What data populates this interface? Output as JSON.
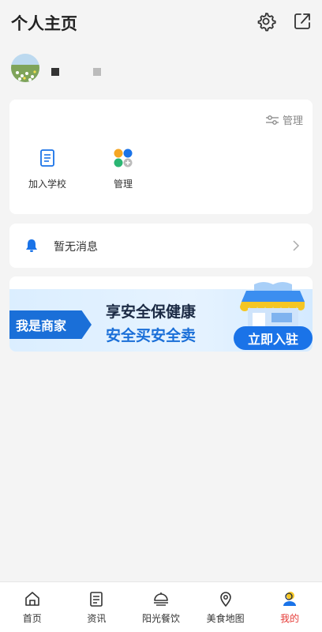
{
  "header": {
    "title": "个人主页"
  },
  "apps_card": {
    "manage_link": "管理",
    "apps": [
      {
        "label": "加入学校",
        "icon": "document-icon"
      },
      {
        "label": "管理",
        "icon": "app-grid-icon"
      }
    ]
  },
  "message": {
    "text": "暂无消息"
  },
  "banner": {
    "merchant_label": "我是商家",
    "slogan_line1": "享安全保健康",
    "slogan_line2": "安全买安全卖",
    "join_button": "立即入驻"
  },
  "tabs": [
    {
      "label": "首页",
      "icon": "home-icon",
      "active": false
    },
    {
      "label": "资讯",
      "icon": "news-icon",
      "active": false
    },
    {
      "label": "阳光餐饮",
      "icon": "dining-icon",
      "active": false
    },
    {
      "label": "美食地图",
      "icon": "map-pin-icon",
      "active": false
    },
    {
      "label": "我的",
      "icon": "profile-icon",
      "active": true
    }
  ],
  "colors": {
    "accent": "#1a73e8",
    "active_tab": "#e53935"
  }
}
